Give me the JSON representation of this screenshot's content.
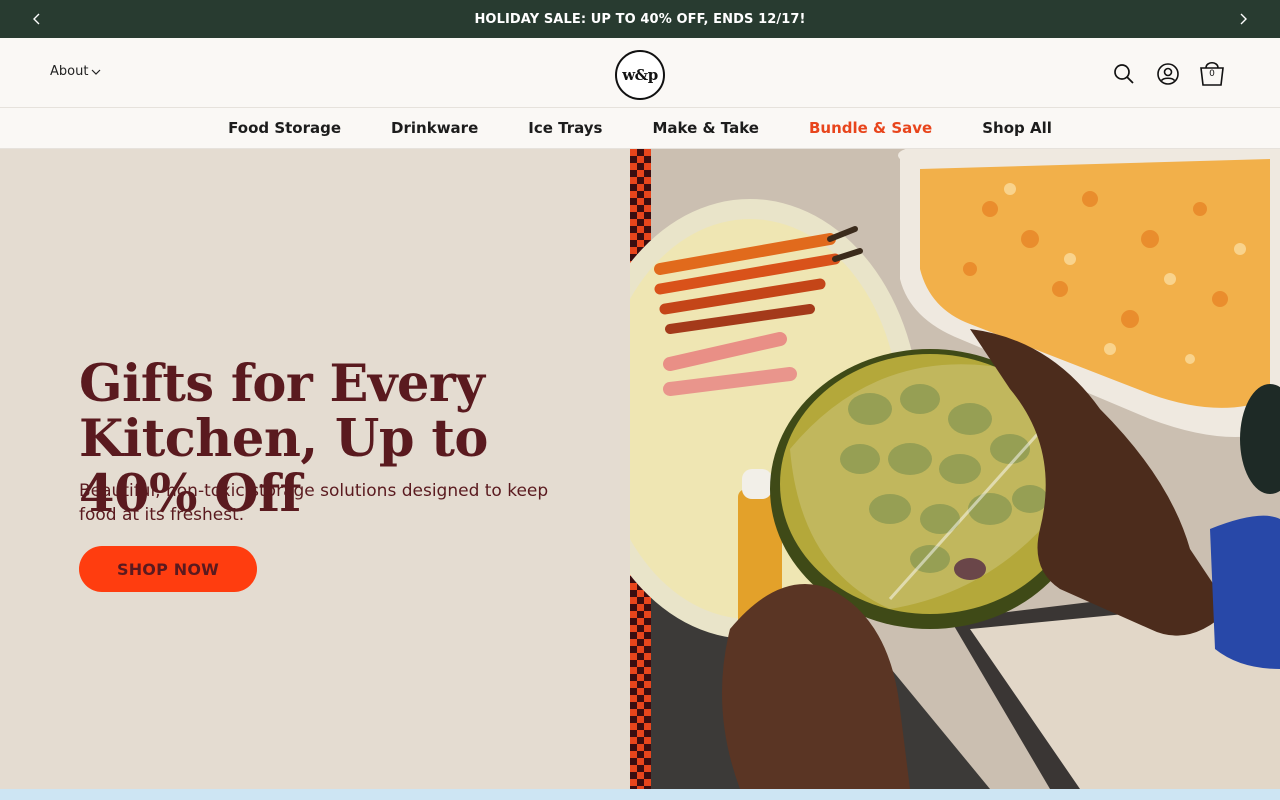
{
  "announcement": {
    "text": "HOLIDAY SALE: UP TO 40% OFF, ENDS 12/17!",
    "prev_icon": "chevron-left-icon",
    "next_icon": "chevron-right-icon"
  },
  "header": {
    "about_label": "About",
    "logo_text": "w&p",
    "cart_count": "0",
    "icons": [
      "search-icon",
      "account-icon",
      "cart-icon"
    ]
  },
  "nav": {
    "items": [
      {
        "label": "Food Storage"
      },
      {
        "label": "Drinkware"
      },
      {
        "label": "Ice Trays"
      },
      {
        "label": "Make & Take"
      },
      {
        "label": "Bundle & Save",
        "accent": true
      },
      {
        "label": "Shop All"
      }
    ]
  },
  "hero": {
    "title": "Gifts for Every Kitchen, Up to 40% Off",
    "subtitle": "Beautiful, non-toxic storage solutions designed to keep food at its freshest.",
    "cta_label": "SHOP NOW"
  },
  "colors": {
    "announcement_bg": "#283b30",
    "hero_bg": "#e4dcd1",
    "heading": "#5a1a1f",
    "accent": "#e8451c",
    "cta": "#ff3d0f"
  }
}
